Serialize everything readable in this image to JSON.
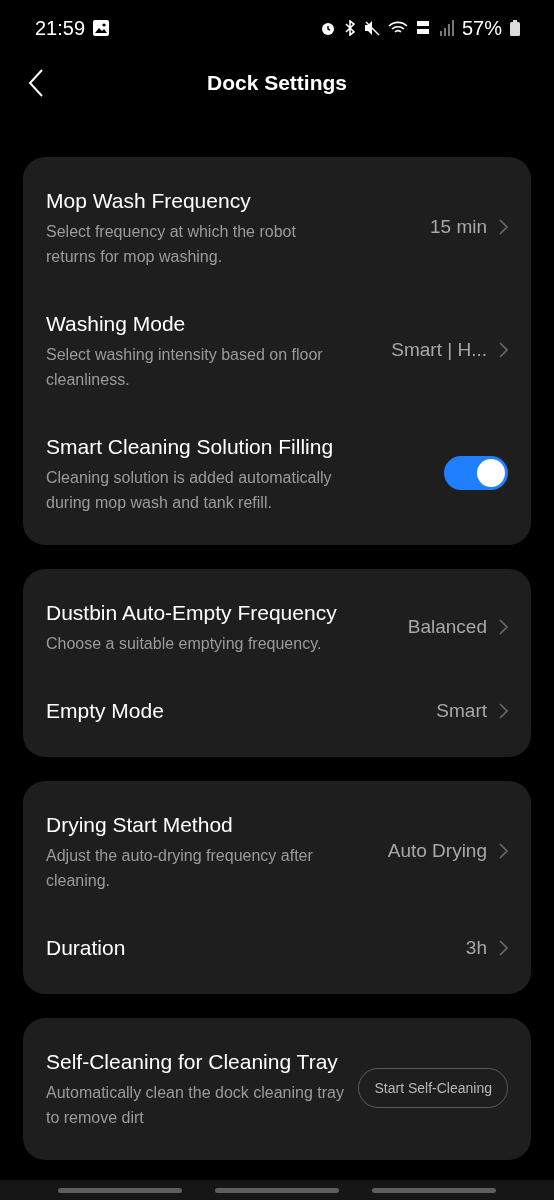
{
  "status_bar": {
    "time": "21:59",
    "battery": "57%"
  },
  "header": {
    "title": "Dock Settings"
  },
  "cards": [
    {
      "rows": [
        {
          "kind": "value",
          "title": "Mop Wash Frequency",
          "description": "Select frequency at which the robot returns for mop washing.",
          "value": "15 min"
        },
        {
          "kind": "value",
          "title": "Washing Mode",
          "description": "Select washing intensity based on floor cleanliness.",
          "value": "Smart | H..."
        },
        {
          "kind": "toggle",
          "title": "Smart Cleaning Solution Filling",
          "description": "Cleaning solution is added automatically during mop wash and tank refill.",
          "on": true
        }
      ]
    },
    {
      "rows": [
        {
          "kind": "value",
          "title": "Dustbin Auto-Empty Frequency",
          "description": "Choose a suitable emptying frequency.",
          "value": "Balanced"
        },
        {
          "kind": "value",
          "title": "Empty Mode",
          "value": "Smart"
        }
      ]
    },
    {
      "rows": [
        {
          "kind": "value",
          "title": "Drying Start Method",
          "description": "Adjust the auto-drying frequency after cleaning.",
          "value": "Auto Drying"
        },
        {
          "kind": "value",
          "title": "Duration",
          "value": "3h"
        }
      ]
    },
    {
      "rows": [
        {
          "kind": "button",
          "title": "Self-Cleaning for Cleaning Tray",
          "description": "Automatically clean the dock cleaning tray to remove dirt",
          "button": "Start Self-Cleaning"
        }
      ]
    }
  ]
}
